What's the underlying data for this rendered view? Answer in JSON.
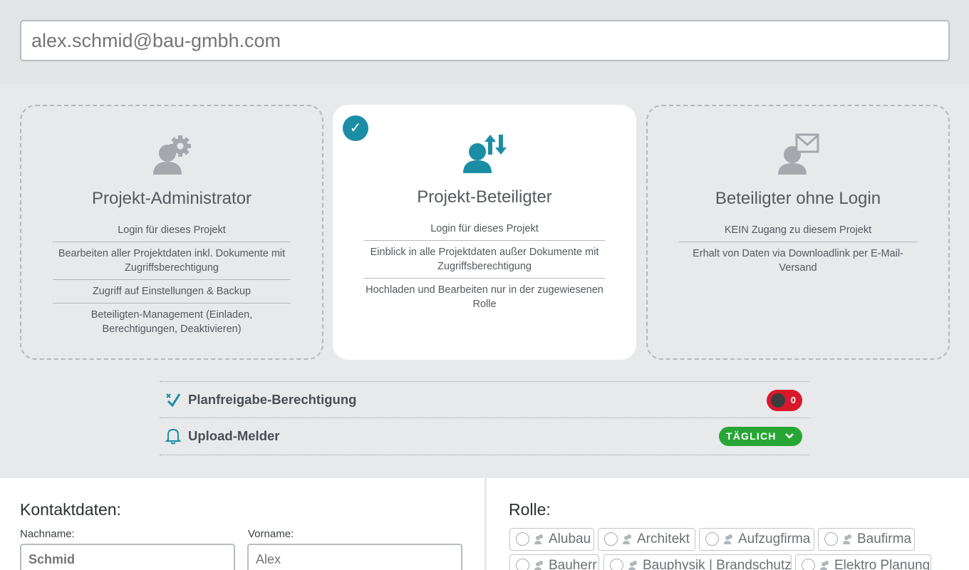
{
  "email": {
    "placeholder": "alex.schmid@bau-gmbh.com"
  },
  "roles": [
    {
      "title": "Projekt-Administrator",
      "icon": "user-gear-icon",
      "selected": false,
      "features": [
        "Login für dieses Projekt",
        "Bearbeiten aller Projektdaten inkl. Dokumente mit Zugriffsberechtigung",
        "Zugriff auf Einstellungen & Backup",
        "Beteiligten-Management (Einladen, Berechtigungen, Deaktivieren)"
      ]
    },
    {
      "title": "Projekt-Beteiligter",
      "icon": "user-transfer-icon",
      "selected": true,
      "features": [
        "Login für dieses Projekt",
        "Einblick in alle Projektdaten außer Dokumente mit Zugriffsberechtigung",
        "Hochladen und Bearbeiten nur in der zugewiesenen Rolle"
      ]
    },
    {
      "title": "Beteiligter ohne Login",
      "icon": "user-mail-icon",
      "selected": false,
      "features": [
        "KEIN Zugang zu diesem Projekt",
        "Erhalt von Daten via Downloadlink per E-Mail-Versand"
      ]
    }
  ],
  "settings": {
    "plan_approval": {
      "label": "Planfreigabe-Berechtigung",
      "toggle_text": "0",
      "enabled": false
    },
    "upload_notifier": {
      "label": "Upload-Melder",
      "value": "TÄGLICH"
    }
  },
  "contact": {
    "title": "Kontaktdaten:",
    "lastname_label": "Nachname:",
    "lastname_value": "Schmid",
    "firstname_label": "Vorname:",
    "firstname_placeholder": "Alex"
  },
  "role_section": {
    "title": "Rolle:",
    "options": [
      "Alubau",
      "Architekt",
      "Aufzugfirma",
      "Baufirma",
      "Bauherr",
      "Bauphysik | Brandschutz",
      "Elektro Planung"
    ]
  },
  "colors": {
    "accent": "#1b8ea6",
    "toggle_off": "#d7182a",
    "pill_green": "#27a635",
    "icon_grey": "#a5a9ad"
  }
}
